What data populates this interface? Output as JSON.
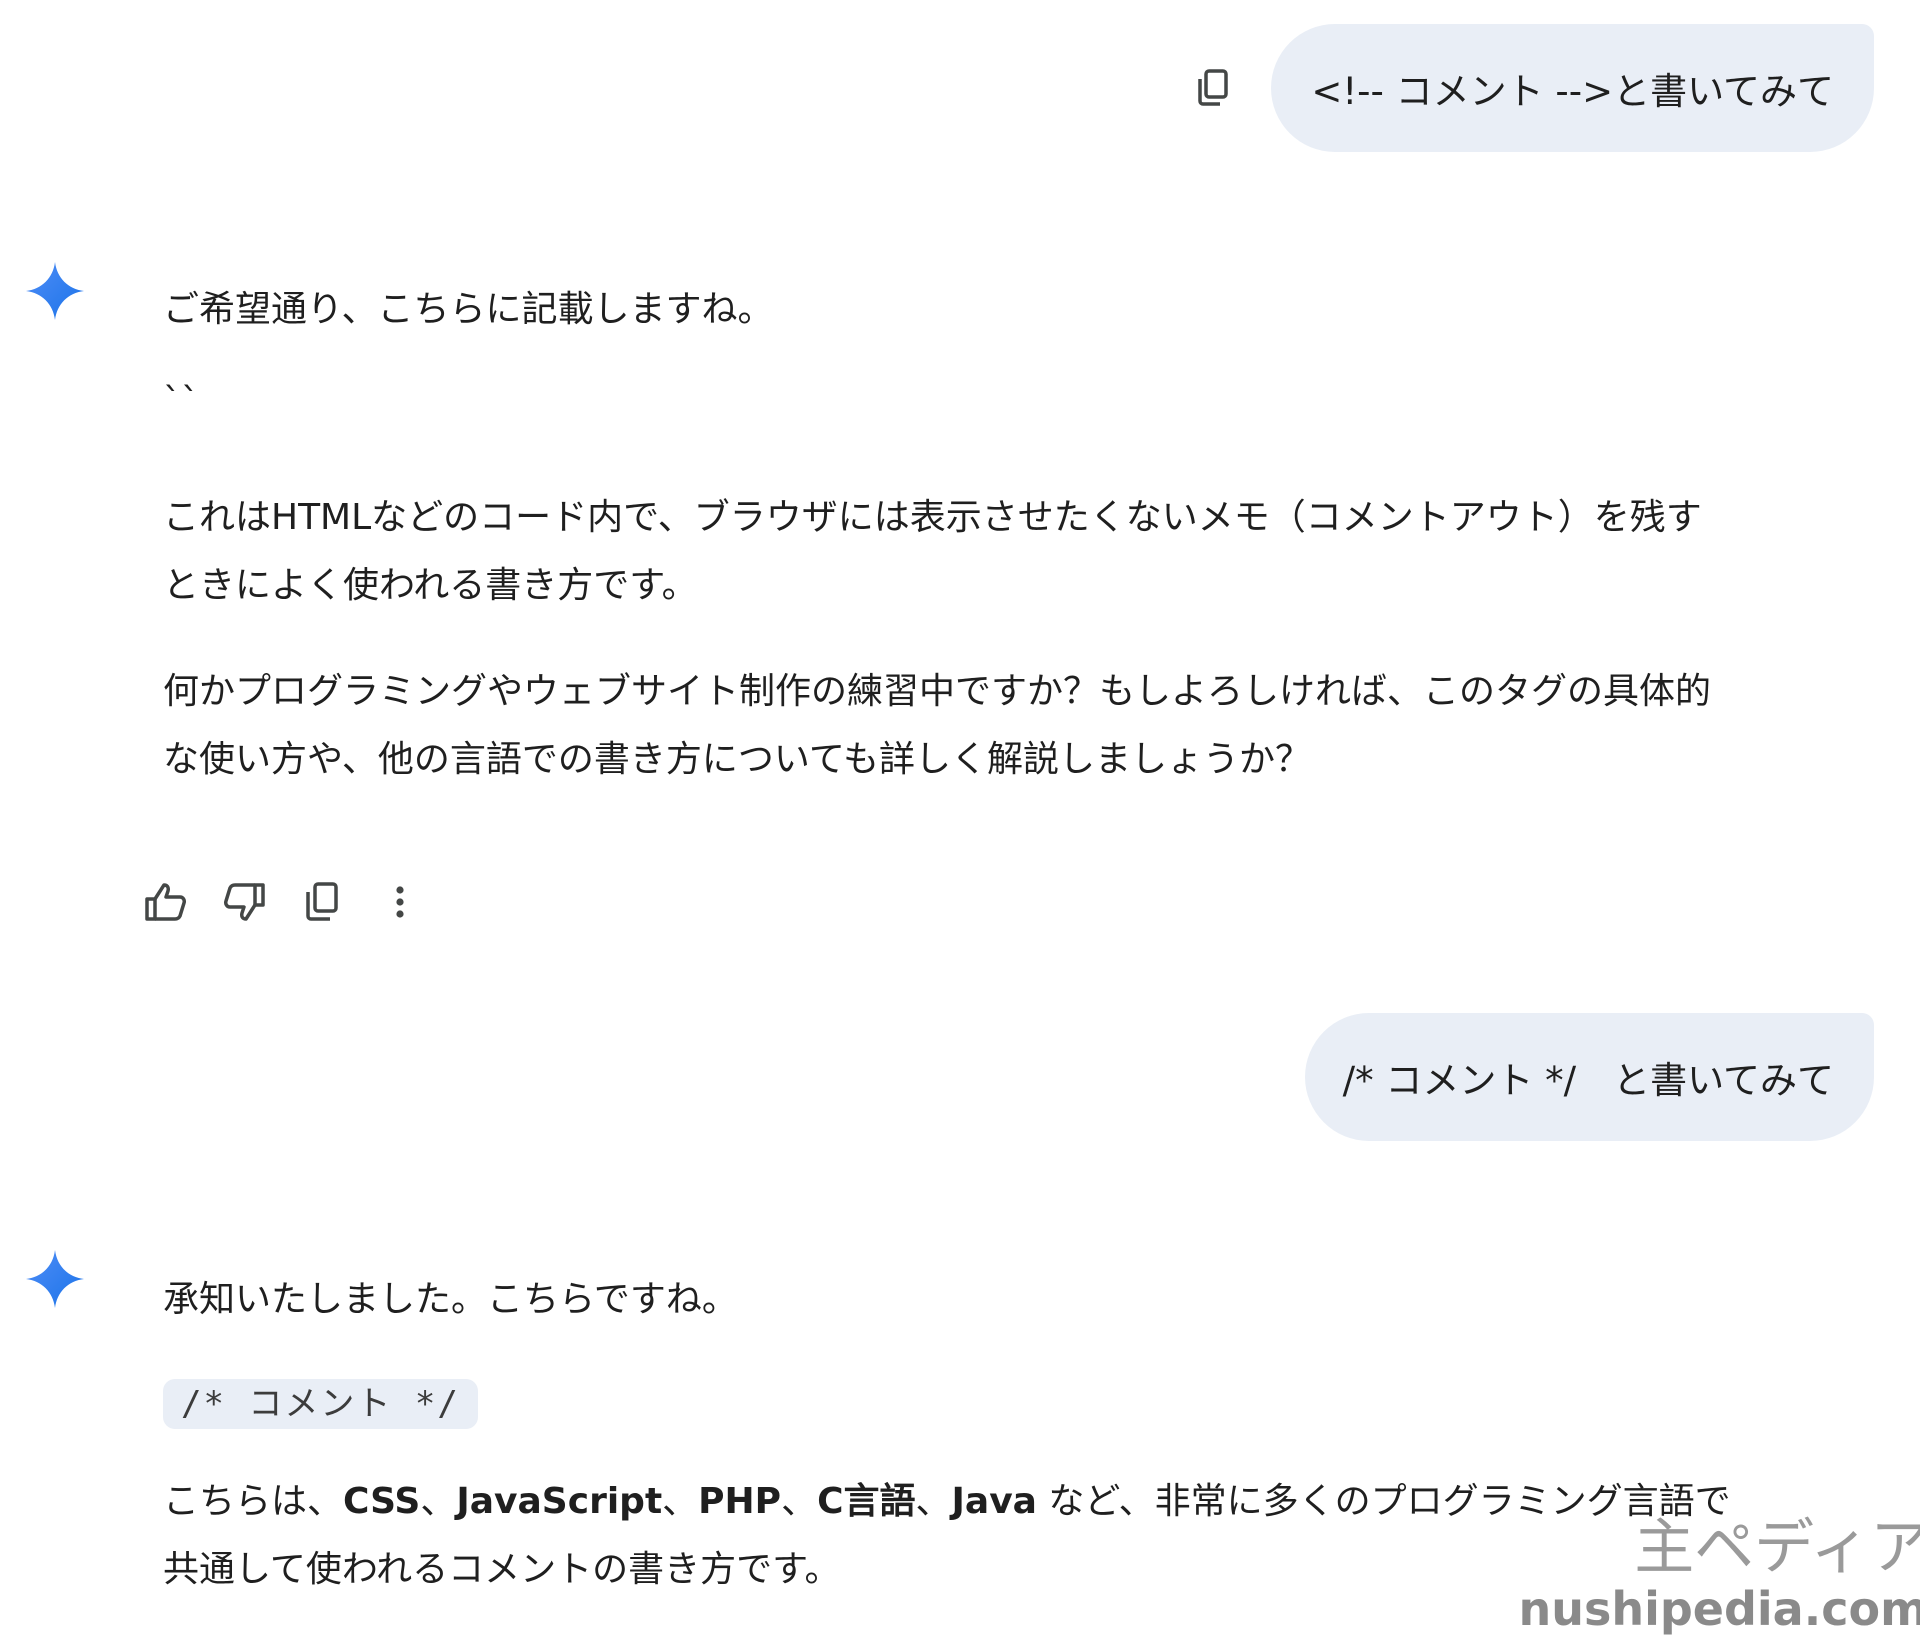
{
  "conversation": {
    "user_msg_1": "<!-- コメント -->と書いてみて",
    "reply_1": {
      "line1": "ご希望通り、こちらに記載しますね。",
      "line2": "``",
      "para1_line1": "これはHTMLなどのコード内で、ブラウザには表示させたくないメモ（コメントアウト）を残す",
      "para1_line2": "ときによく使われる書き方です。",
      "para2_line1": "何かプログラミングやウェブサイト制作の練習中ですか？もしよろしければ、このタグの具体的",
      "para2_line2": "な使い方や、他の言語での書き方についても詳しく解説しましょうか？"
    },
    "user_msg_2": "/* コメント */　と書いてみて",
    "reply_2": {
      "line1": "承知いたしました。こちらですね。",
      "code": "/* コメント */",
      "para_prefix": "こちらは、",
      "lang_css": "CSS",
      "sep": "、",
      "lang_js": "JavaScript",
      "lang_php": "PHP",
      "lang_c": "C言語",
      "lang_java": "Java",
      "para_suffix": " など、非常に多くのプログラミング言語で",
      "para_line2": "共通して使われるコメントの書き方です。"
    }
  },
  "icons": {
    "copy": "copy-icon",
    "gemini": "gemini-sparkle-icon",
    "thumbs_up": "thumbs-up-icon",
    "thumbs_down": "thumbs-down-icon",
    "more": "more-vert-icon"
  },
  "colors": {
    "bubble_bg": "#e9eef6",
    "gemini_blue": "#4285f4",
    "icon_gray": "#444746"
  },
  "watermark": {
    "jp": "主ペディア",
    "url": "nushipedia.com"
  }
}
